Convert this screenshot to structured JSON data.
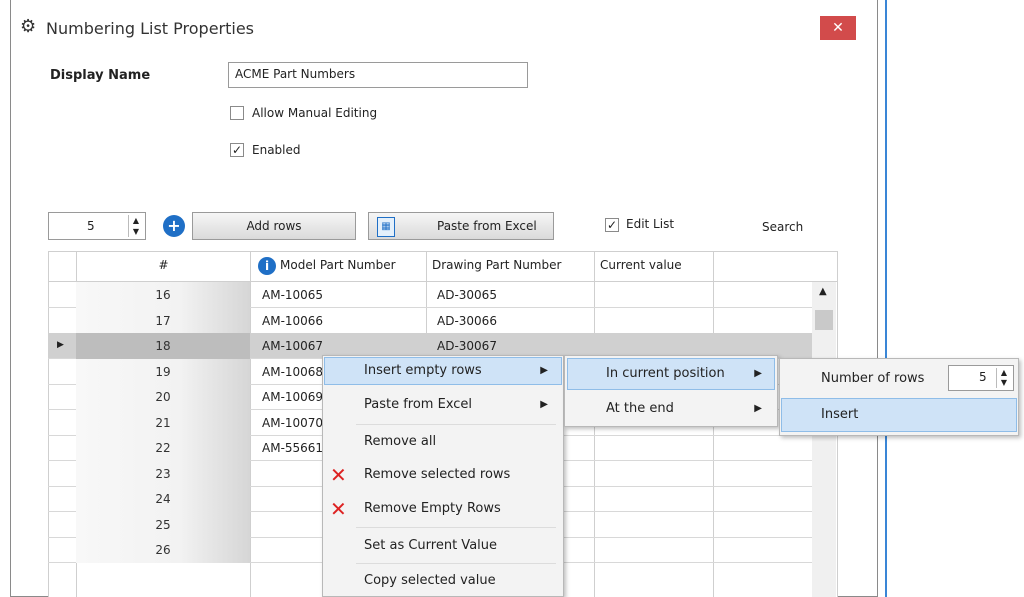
{
  "window": {
    "title": "Numbering List Properties",
    "close_glyph": "✕"
  },
  "form": {
    "display_name_label": "Display Name",
    "display_name_value": "ACME Part Numbers",
    "allow_manual_editing_label": "Allow Manual Editing",
    "allow_manual_editing_checked": false,
    "enabled_label": "Enabled",
    "enabled_checked": true
  },
  "toolbar": {
    "rows_count": "5",
    "add_rows_label": "Add rows",
    "paste_label": "Paste from Excel",
    "edit_list_label": "Edit List",
    "edit_list_checked": true,
    "search_label": "Search"
  },
  "grid": {
    "columns": [
      "#",
      "Model Part Number",
      "Drawing Part Number",
      "Current value"
    ],
    "rows": [
      {
        "num": "16",
        "model": "AM-10065",
        "drawing": "AD-30065",
        "current": ""
      },
      {
        "num": "17",
        "model": "AM-10066",
        "drawing": "AD-30066",
        "current": ""
      },
      {
        "num": "18",
        "model": "AM-10067",
        "drawing": "AD-30067",
        "current": ""
      },
      {
        "num": "19",
        "model": "AM-10068",
        "drawing": "",
        "current": ""
      },
      {
        "num": "20",
        "model": "AM-10069",
        "drawing": "",
        "current": ""
      },
      {
        "num": "21",
        "model": "AM-10070",
        "drawing": "",
        "current": ""
      },
      {
        "num": "22",
        "model": "AM-55661",
        "drawing": "",
        "current": ""
      },
      {
        "num": "23",
        "model": "",
        "drawing": "",
        "current": ""
      },
      {
        "num": "24",
        "model": "",
        "drawing": "",
        "current": ""
      },
      {
        "num": "25",
        "model": "",
        "drawing": "",
        "current": ""
      },
      {
        "num": "26",
        "model": "",
        "drawing": "",
        "current": ""
      }
    ],
    "selected_row": "18"
  },
  "context_menu": {
    "items": [
      {
        "label": "Insert empty rows",
        "submenu": true
      },
      {
        "label": "Paste from Excel",
        "submenu": true
      },
      {
        "label": "Remove all",
        "submenu": false
      },
      {
        "label": "Remove selected rows",
        "submenu": false,
        "icon": "red-x-icon"
      },
      {
        "label": "Remove Empty Rows",
        "submenu": false,
        "icon": "red-x-icon"
      },
      {
        "label": "Set as Current Value",
        "submenu": false
      },
      {
        "label": "Copy selected value",
        "submenu": false
      }
    ]
  },
  "submenu": {
    "items": [
      {
        "label": "In current position",
        "submenu": true
      },
      {
        "label": "At the end",
        "submenu": true
      }
    ]
  },
  "insert_panel": {
    "number_of_rows_label": "Number of rows",
    "number_of_rows_value": "5",
    "insert_label": "Insert"
  },
  "colors": {
    "accent": "#3a86d6",
    "close": "#d24b4b",
    "highlight": "#cfe3f7",
    "red_x": "#dd2222"
  }
}
